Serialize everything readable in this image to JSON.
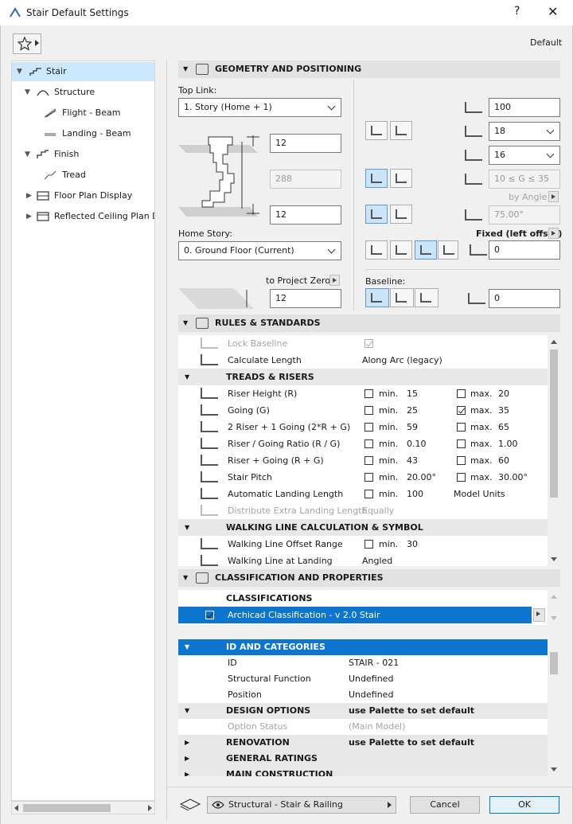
{
  "window": {
    "title": "Stair Default Settings",
    "help": "?",
    "close": "✕",
    "default_label": "Default"
  },
  "tree": {
    "items": [
      {
        "label": "Stair",
        "chev": "expanded"
      },
      {
        "label": "Structure",
        "chev": "expanded"
      },
      {
        "label": "Flight - Beam",
        "chev": ""
      },
      {
        "label": "Landing - Beam",
        "chev": ""
      },
      {
        "label": "Finish",
        "chev": "expanded"
      },
      {
        "label": "Tread",
        "chev": ""
      },
      {
        "label": "Floor Plan Display",
        "chev": "collapsed"
      },
      {
        "label": "Reflected Ceiling Plan Di",
        "chev": "collapsed"
      }
    ]
  },
  "geometry": {
    "title": "GEOMETRY AND POSITIONING",
    "top_link_label": "Top Link:",
    "top_link_value": "1. Story (Home + 1)",
    "top_offset": "12",
    "total_height": "288",
    "bottom_offset": "12",
    "home_story_label": "Home Story:",
    "home_story_value": "0. Ground Floor (Current)",
    "to_project_zero_label": "to Project Zero",
    "project_zero_value": "12",
    "width_value": "100",
    "riser_count": "18",
    "tread_count": "16",
    "going_rule": "10 ≤ G ≤ 35",
    "by_angle_label": "by Angle",
    "angle_value": "75.00°",
    "fixed_offset_label": "Fixed (left offset)",
    "offset_value": "0",
    "baseline_label": "Baseline:",
    "baseline_offset": "0"
  },
  "rules": {
    "title": "RULES & STANDARDS",
    "lock_baseline": "Lock Baseline",
    "calc_length": "Calculate Length",
    "calc_length_value": "Along Arc (legacy)",
    "treads_title": "TREADS & RISERS",
    "rows": [
      {
        "label": "Riser Height (R)",
        "min_label": "min.",
        "min": "15",
        "max_label": "max.",
        "max": "20",
        "max_checked": false
      },
      {
        "label": "Going (G)",
        "min_label": "min.",
        "min": "25",
        "max_label": "max.",
        "max": "35",
        "max_checked": true
      },
      {
        "label": "2 Riser + 1 Going (2*R + G)",
        "min_label": "min.",
        "min": "59",
        "max_label": "max.",
        "max": "65",
        "max_checked": false
      },
      {
        "label": "Riser / Going Ratio (R / G)",
        "min_label": "min.",
        "min": "0.10",
        "max_label": "max.",
        "max": "1.00",
        "max_checked": false
      },
      {
        "label": "Riser + Going (R + G)",
        "min_label": "min.",
        "min": "43",
        "max_label": "max.",
        "max": "60",
        "max_checked": false
      },
      {
        "label": "Stair Pitch",
        "min_label": "min.",
        "min": "20.00°",
        "max_label": "max.",
        "max": "30.00°",
        "max_checked": false
      }
    ],
    "auto_landing": "Automatic Landing Length",
    "auto_landing_min": "min.",
    "auto_landing_value": "100",
    "auto_landing_units": "Model Units",
    "distribute": "Distribute Extra Landing Length",
    "distribute_value": "Equally",
    "walking_title": "WALKING LINE CALCULATION & SYMBOL",
    "walking_offset": "Walking Line Offset Range",
    "walking_offset_min": "min.",
    "walking_offset_value": "30",
    "walking_landing": "Walking Line at Landing",
    "walking_landing_value": "Angled"
  },
  "classification": {
    "title": "CLASSIFICATION AND PROPERTIES",
    "classifications": "CLASSIFICATIONS",
    "class_item": "Archicad Classification - v 2.0 Stair",
    "id_categories": "ID AND CATEGORIES",
    "props": [
      {
        "label": "ID",
        "value": "STAIR - 021"
      },
      {
        "label": "Structural Function",
        "value": "Undefined"
      },
      {
        "label": "Position",
        "value": "Undefined"
      }
    ],
    "design_options": "DESIGN OPTIONS",
    "design_options_value": "use Palette to set default",
    "option_status": "Option Status",
    "option_status_value": "(Main Model)",
    "renovation": "RENOVATION",
    "renovation_value": "use Palette to set default",
    "general_ratings": "GENERAL RATINGS",
    "main_construction": "MAIN CONSTRUCTION"
  },
  "footer": {
    "layer": "Structural - Stair & Railing",
    "cancel": "Cancel",
    "ok": "OK"
  }
}
